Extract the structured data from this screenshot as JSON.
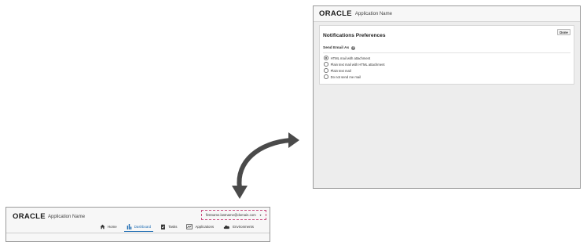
{
  "notifications_window": {
    "brand": "ORACLE",
    "app_name": "Application Name",
    "panel": {
      "title": "Notifications Preferences",
      "done_label": "Done",
      "section_label": "Send Email As",
      "options": [
        {
          "label": "HTML mail with attachment",
          "selected": true
        },
        {
          "label": "Plain text mail with HTML attachment",
          "selected": false
        },
        {
          "label": "Plain text mail",
          "selected": false
        },
        {
          "label": "Do not send me mail",
          "selected": false
        }
      ]
    }
  },
  "dashboard_window": {
    "brand": "ORACLE",
    "app_name": "Application Name",
    "user_email": "firstname.lastname@domain.com",
    "nav": [
      {
        "label": "Home",
        "icon": "home-icon",
        "active": false
      },
      {
        "label": "Dashboard",
        "icon": "bar-chart-icon",
        "active": true
      },
      {
        "label": "Tasks",
        "icon": "clipboard-check-icon",
        "active": false
      },
      {
        "label": "Applications",
        "icon": "applications-icon",
        "active": false
      },
      {
        "label": "Environments",
        "icon": "cloud-icon",
        "active": false
      }
    ]
  },
  "colors": {
    "accent": "#1f6db3",
    "highlight_border": "#c8457a",
    "arrow": "#4a4a4a"
  }
}
